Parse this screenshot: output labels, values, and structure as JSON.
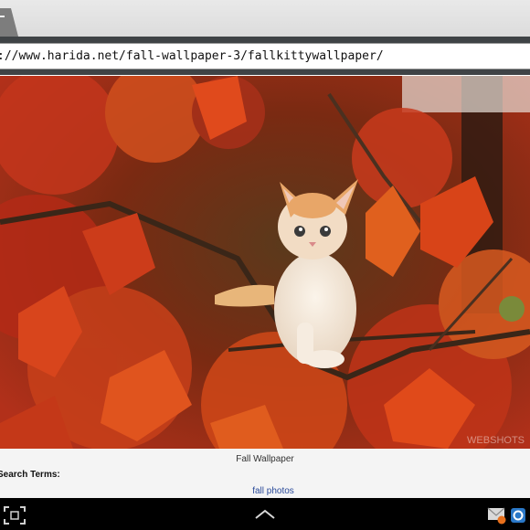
{
  "browser": {
    "url": "://www.harida.net/fall-wallpaper-3/fallkittywallpaper/"
  },
  "page": {
    "image_watermark": "WEBSHOTS",
    "caption": "Fall Wallpaper",
    "search_terms_label": "Search Terms:",
    "search_term_link": "fall photos"
  },
  "system_bar": {
    "icons": [
      "screenshot-icon",
      "up-chevron-icon",
      "mail-notification-icon",
      "app-notification-icon"
    ]
  },
  "colors": {
    "link": "#2a4a9a",
    "nav_bar": "#000000",
    "url_strip": "#3f4346"
  }
}
